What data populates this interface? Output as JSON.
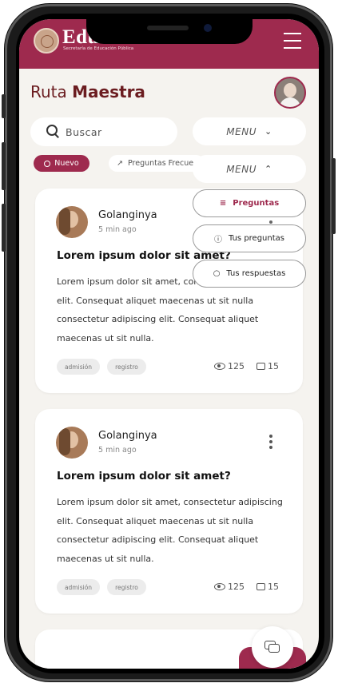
{
  "header": {
    "logo_text": "Educación",
    "logo_subtitle": "Secretaría de Educación Pública",
    "menu_icon": "hamburger-icon"
  },
  "page": {
    "title_light": "Ruta",
    "title_bold": "Maestra"
  },
  "search": {
    "placeholder": "Buscar",
    "icon": "search-icon"
  },
  "menus": {
    "collapsed_label": "MENU",
    "expanded_label": "MENU"
  },
  "filters": {
    "new_label": "Nuevo",
    "faq_label": "Preguntas Frecue"
  },
  "dropdown": {
    "items": [
      {
        "label": "Preguntas",
        "icon": "list-icon"
      },
      {
        "label": "Tus preguntas",
        "icon": "question-icon"
      },
      {
        "label": "Tus respuestas",
        "icon": "chat-icon"
      }
    ]
  },
  "posts": [
    {
      "author": "Golanginya",
      "time": "5 min ago",
      "title": "Lorem ipsum dolor sit amet?",
      "body": "Lorem ipsum dolor sit amet, consectetur adipiscing elit. Consequat aliquet maecenas ut sit nulla consectetur adipiscing elit. Consequat aliquet maecenas ut sit nulla.",
      "tags": [
        "admisión",
        "registro"
      ],
      "views": "125",
      "comments": "15"
    },
    {
      "author": "Golanginya",
      "time": "5 min ago",
      "title": "Lorem ipsum dolor sit amet?",
      "body": "Lorem ipsum dolor sit amet, consectetur adipiscing elit. Consequat aliquet maecenas ut sit nulla consectetur adipiscing elit. Consequat aliquet maecenas ut sit nulla.",
      "tags": [
        "admisión",
        "registro"
      ],
      "views": "125",
      "comments": "15"
    }
  ],
  "colors": {
    "brand": "#9e2a4e",
    "title": "#6b1c20",
    "background": "#f5f3ef"
  }
}
